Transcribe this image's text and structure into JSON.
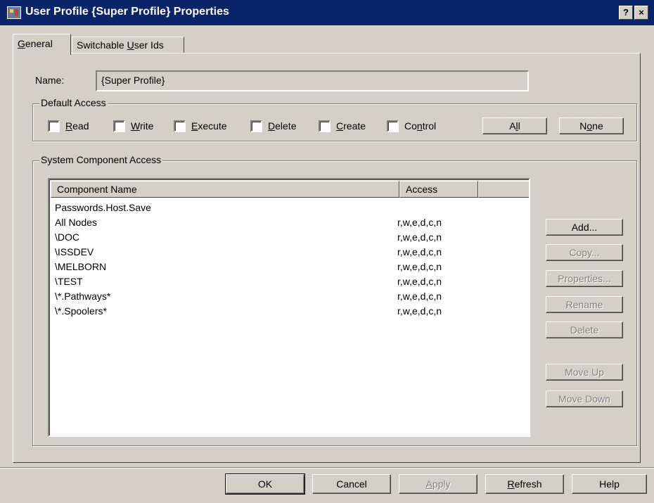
{
  "window": {
    "title": "User Profile {Super Profile} Properties",
    "help_button": "?",
    "close_button": "×"
  },
  "tabs": [
    {
      "pre": "",
      "accel": "G",
      "post": "eneral",
      "active": true
    },
    {
      "pre": "Switchable ",
      "accel": "U",
      "post": "ser Ids",
      "active": false
    }
  ],
  "name_field": {
    "label": "Name:",
    "value": "{Super Profile}"
  },
  "default_access": {
    "title": "Default Access",
    "checkboxes": [
      {
        "pre": "",
        "accel": "R",
        "post": "ead",
        "checked": false
      },
      {
        "pre": "",
        "accel": "W",
        "post": "rite",
        "checked": false
      },
      {
        "pre": "",
        "accel": "E",
        "post": "xecute",
        "checked": false
      },
      {
        "pre": "",
        "accel": "D",
        "post": "elete",
        "checked": false
      },
      {
        "pre": "",
        "accel": "C",
        "post": "reate",
        "checked": false
      },
      {
        "pre": "Co",
        "accel": "n",
        "post": "trol",
        "checked": false
      }
    ],
    "all_button": {
      "pre": "A",
      "accel": "l",
      "post": "l"
    },
    "none_button": {
      "pre": "N",
      "accel": "o",
      "post": "ne"
    }
  },
  "system_access": {
    "title": "System Component Access",
    "columns": [
      "Component Name",
      "Access"
    ],
    "rows": [
      {
        "name": "Passwords.Host.Save",
        "access": ""
      },
      {
        "name": "All Nodes",
        "access": "r,w,e,d,c,n"
      },
      {
        "name": "\\DOC",
        "access": "r,w,e,d,c,n"
      },
      {
        "name": "\\ISSDEV",
        "access": "r,w,e,d,c,n"
      },
      {
        "name": "\\MELBORN",
        "access": "r,w,e,d,c,n"
      },
      {
        "name": "\\TEST",
        "access": "r,w,e,d,c,n"
      },
      {
        "name": "\\*.Pathways*",
        "access": "r,w,e,d,c,n"
      },
      {
        "name": "\\*.Spoolers*",
        "access": "r,w,e,d,c,n"
      }
    ],
    "buttons": {
      "add": "Add...",
      "copy": "Copy...",
      "properties": "Properties...",
      "rename": "Rename",
      "delete": "Delete",
      "move_up": "Move Up",
      "move_down": "Move Down"
    }
  },
  "dialog_buttons": {
    "ok": "OK",
    "cancel": "Cancel",
    "apply": {
      "pre": "",
      "accel": "A",
      "post": "pply"
    },
    "refresh": {
      "pre": "",
      "accel": "R",
      "post": "efresh"
    },
    "help": "Help"
  },
  "colors": {
    "title_bar": "#0a246a",
    "face": "#d4d0c8",
    "disabled_text": "#808080"
  }
}
